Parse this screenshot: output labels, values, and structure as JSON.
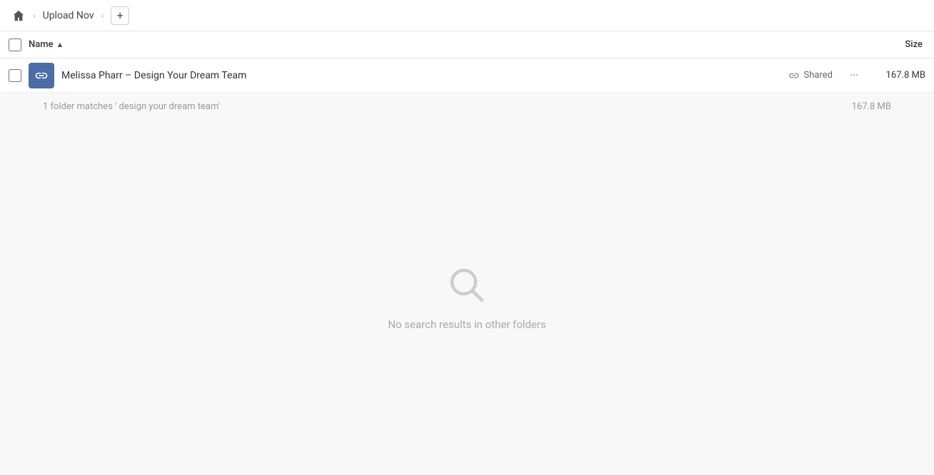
{
  "breadcrumb": {
    "home_label": "Home",
    "items": [
      {
        "label": "Upload Nov"
      }
    ],
    "add_button": "+"
  },
  "table": {
    "header": {
      "checkbox_label": "Select all",
      "name_label": "Name",
      "sort_indicator": "▲",
      "size_label": "Size"
    },
    "rows": [
      {
        "name": "Melissa Pharr – Design Your Dream Team",
        "shared_label": "Shared",
        "size": "167.8 MB",
        "icon_type": "link"
      }
    ],
    "match_info": "1 folder matches ' design your dream team'",
    "match_size": "167.8 MB"
  },
  "empty_state": {
    "icon": "search-icon",
    "message": "No search results in other folders"
  }
}
